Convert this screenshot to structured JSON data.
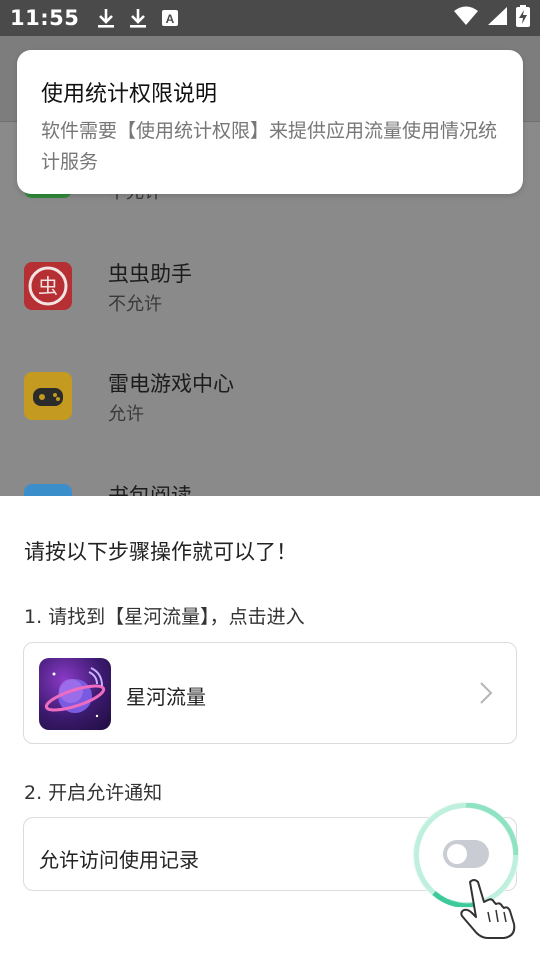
{
  "status_bar": {
    "time": "11:55",
    "icons": [
      "download-icon",
      "download-icon",
      "font-icon",
      "wifi-icon",
      "signal-icon",
      "battery-charging-icon"
    ]
  },
  "background_list": {
    "apps": [
      {
        "name": "",
        "status": "不允许"
      },
      {
        "name": "虫虫助手",
        "status": "不允许",
        "icon_color": "#c8373a"
      },
      {
        "name": "雷电游戏中心",
        "status": "允许",
        "icon_color": "#d9ac2a"
      },
      {
        "name": "书包阅读",
        "status": ""
      }
    ]
  },
  "info_dialog": {
    "title": "使用统计权限说明",
    "body": "软件需要【使用统计权限】来提供应用流量使用情况统计服务"
  },
  "sheet": {
    "heading": "请按以下步骤操作就可以了！",
    "step1": "1. 请找到【星河流量】，点击进入",
    "app_name": "星河流量",
    "step2": "2. 开启允许通知",
    "toggle_label": "允许访问使用记录",
    "toggle_on": false
  },
  "colors": {
    "accent_ring": "#3ec99a",
    "toggle_off": "#c9ccd2"
  }
}
